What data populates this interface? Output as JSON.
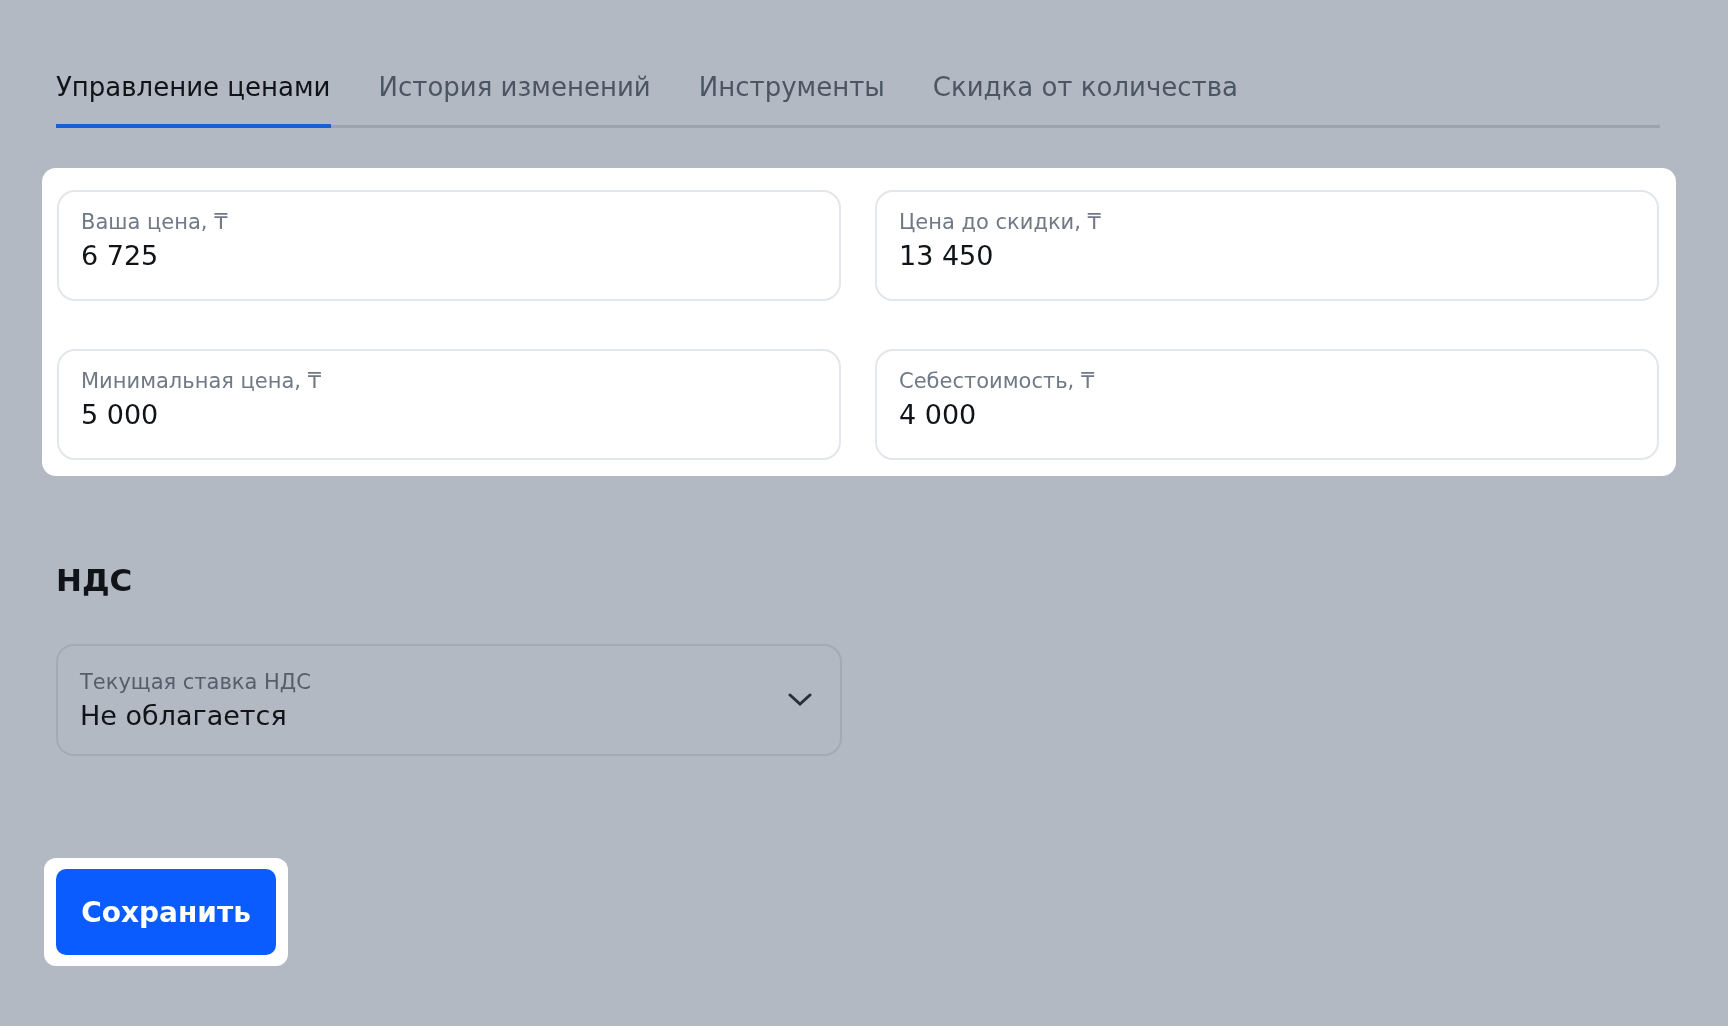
{
  "tabs": [
    {
      "label": "Управление ценами",
      "selected": true
    },
    {
      "label": "История изменений",
      "selected": false
    },
    {
      "label": "Инструменты",
      "selected": false
    },
    {
      "label": "Скидка от количества",
      "selected": false
    }
  ],
  "price_fields": [
    {
      "label": "Ваша цена, ₸",
      "value": "6 725"
    },
    {
      "label": "Цена до скидки, ₸",
      "value": "13 450"
    },
    {
      "label": "Минимальная цена, ₸",
      "value": "5 000"
    },
    {
      "label": "Себестоимость, ₸",
      "value": "4 000"
    }
  ],
  "vat": {
    "heading": "НДС",
    "select": {
      "label": "Текущая ставка НДС",
      "value": "Не облагается"
    }
  },
  "save_button": "Сохранить"
}
